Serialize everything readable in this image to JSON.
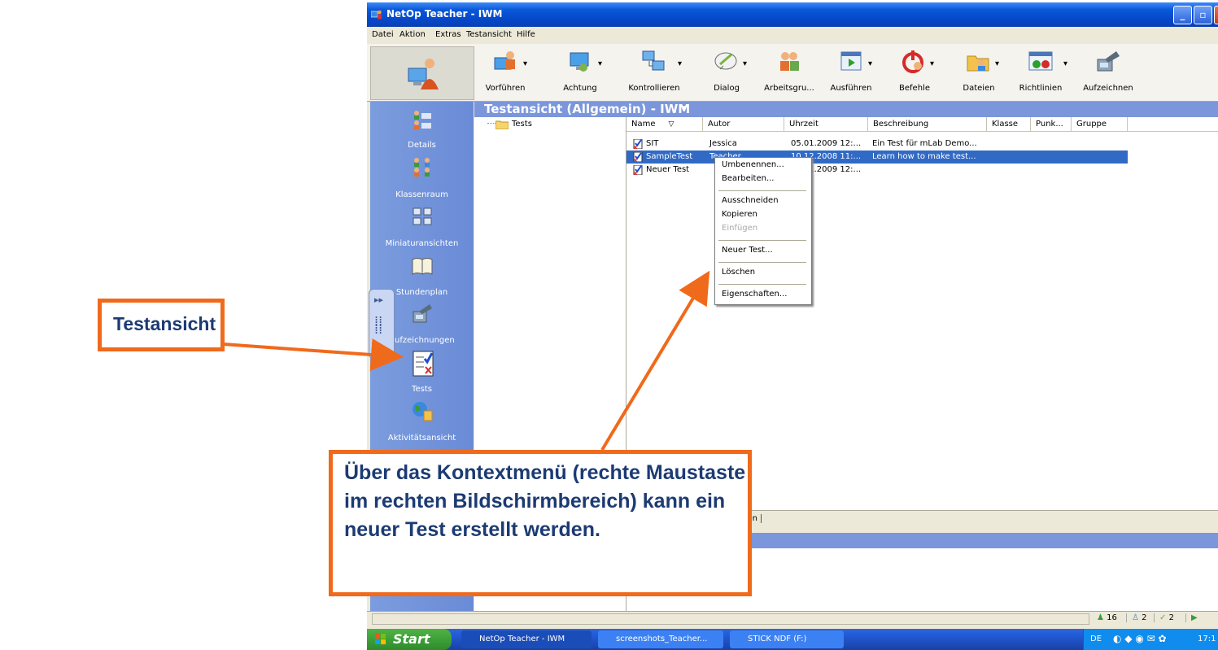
{
  "window": {
    "title": "NetOp Teacher - IWM",
    "controls": [
      "_",
      "▫",
      "✕"
    ]
  },
  "menubar": [
    "Datei",
    "Aktion",
    "Extras",
    "Testansicht",
    "Hilfe"
  ],
  "toolbar": [
    {
      "label": "Vorführen",
      "icon": "presenter-icon"
    },
    {
      "label": "Achtung",
      "icon": "attention-icon"
    },
    {
      "label": "Kontrollieren",
      "icon": "control-icon"
    },
    {
      "label": "Dialog",
      "icon": "dialog-icon"
    },
    {
      "label": "Arbeitsgru...",
      "icon": "workgroup-icon"
    },
    {
      "label": "Ausführen",
      "icon": "run-icon"
    },
    {
      "label": "Befehle",
      "icon": "commands-icon"
    },
    {
      "label": "Dateien",
      "icon": "files-icon"
    },
    {
      "label": "Richtlinien",
      "icon": "policies-icon"
    },
    {
      "label": "Aufzeichnen",
      "icon": "record-icon"
    }
  ],
  "sidebar": [
    {
      "label": "Details",
      "icon": "details-icon"
    },
    {
      "label": "Klassenraum",
      "icon": "classroom-icon"
    },
    {
      "label": "Miniaturansichten",
      "icon": "thumbnails-icon"
    },
    {
      "label": "Stundenplan",
      "icon": "schedule-icon"
    },
    {
      "label": "Aufzeichnungen",
      "icon": "recordings-icon"
    },
    {
      "label": "Tests",
      "icon": "tests-icon"
    },
    {
      "label": "Aktivitätsansicht",
      "icon": "activity-icon"
    }
  ],
  "view_header": "Testansicht (Allgemein) - IWM",
  "tree": {
    "root": "Tests"
  },
  "list": {
    "columns": [
      "Name",
      "Autor",
      "Uhrzeit",
      "Beschreibung",
      "Klasse",
      "Punk...",
      "Gruppe"
    ],
    "rows": [
      {
        "name": "SIT",
        "author": "Jessica",
        "time": "05.01.2009 12:...",
        "description": "Ein Test für mLab Demo..."
      },
      {
        "name": "SampleTest",
        "author": "Teacher",
        "time": "10.12.2008 11:...",
        "description": "Learn how to make test..."
      },
      {
        "name": "Neuer Test",
        "author": "",
        "time": "05.01.2009 12:...",
        "description": ""
      }
    ]
  },
  "context_menu": [
    "Umbenennen...",
    "Bearbeiten...",
    "Ausschneiden",
    "Kopieren",
    "Einfügen",
    "Neuer Test...",
    "Löschen",
    "Eigenschaften..."
  ],
  "bottom_tab": "egen",
  "status": {
    "counts": [
      "16",
      "2",
      "2"
    ]
  },
  "taskbar": {
    "start": "Start",
    "tasks": [
      "NetOp Teacher - IWM",
      "screenshots_Teacher...",
      "STICK NDF (F:)"
    ],
    "lang": "DE",
    "clock": "17:1"
  },
  "annotations": {
    "label1": "Testansicht",
    "label2": "Über das Kontextmenü (rechte Maustaste im rechten Bildschirmbereich) kann ein neuer Test erstellt werden."
  },
  "colors": {
    "accent": "#f06a1c",
    "callout_text": "#1c3b73",
    "selection": "#316ac5",
    "sidebar": "#7b9cde"
  }
}
